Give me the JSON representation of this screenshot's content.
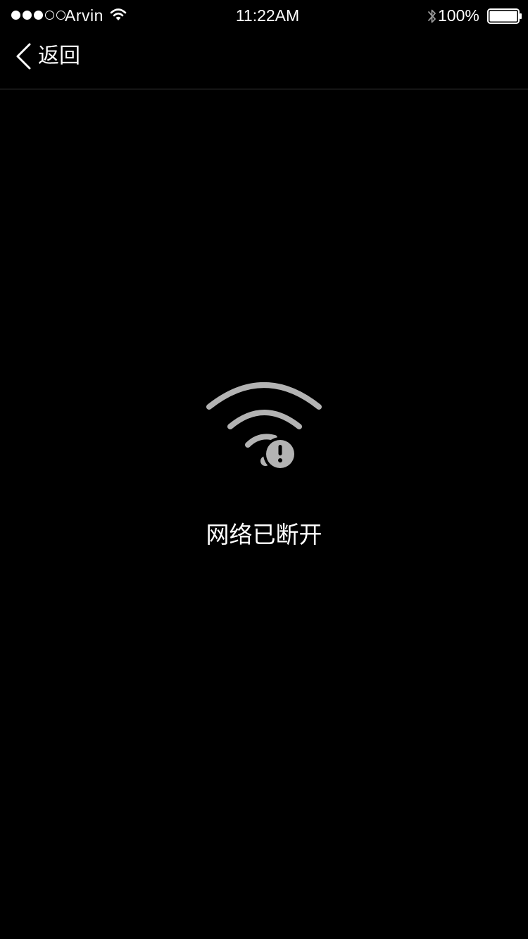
{
  "status_bar": {
    "signal_bars_filled": 3,
    "signal_bars_total": 5,
    "carrier": "Arvin",
    "time": "11:22AM",
    "battery_percent": "100%",
    "battery_level": 1.0,
    "icons": [
      "wifi-icon",
      "bluetooth-icon",
      "battery-icon"
    ]
  },
  "nav": {
    "back_label": "返回",
    "back_icon": "chevron-left-icon"
  },
  "content": {
    "icon": "wifi-disconnected-icon",
    "message": "网络已断开"
  },
  "colors": {
    "background": "#000000",
    "text": "#ffffff",
    "icon_gray": "#b3b3b3",
    "divider": "#3a3a3a"
  }
}
